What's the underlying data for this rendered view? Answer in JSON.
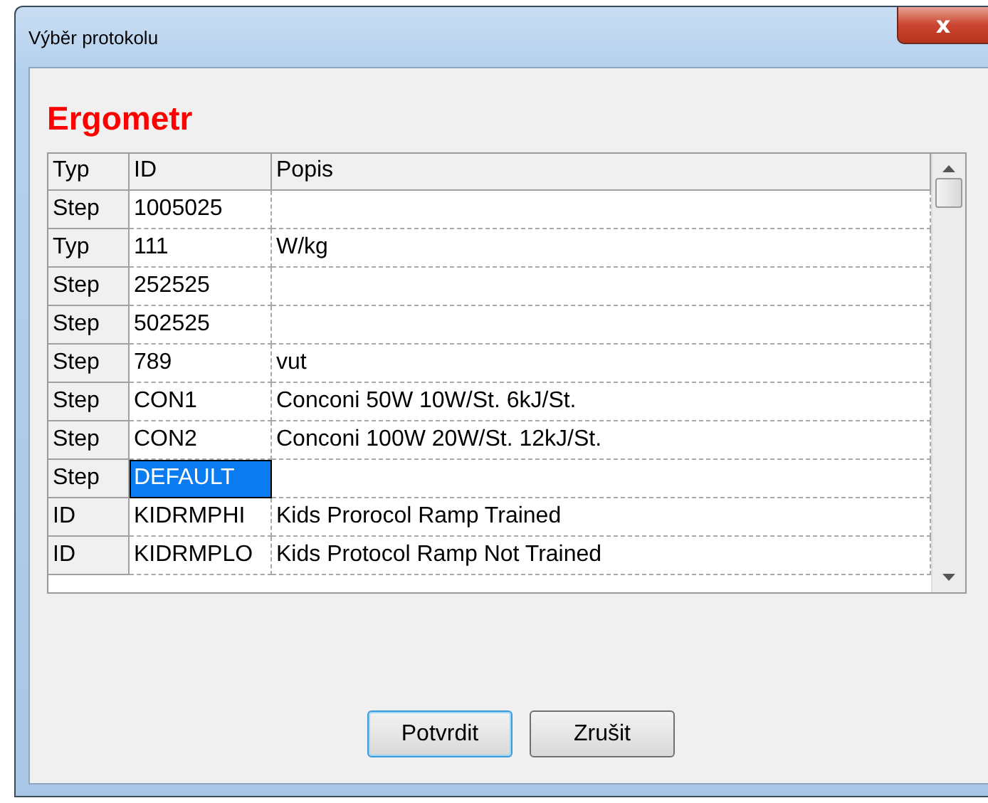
{
  "window": {
    "title": "Výběr protokolu",
    "close": "x"
  },
  "heading": "Ergometr",
  "table": {
    "columns": [
      "Typ",
      "ID",
      "Popis"
    ],
    "rows": [
      {
        "type": "Step",
        "id": "1005025",
        "description": "",
        "selected": false
      },
      {
        "type": "Typ",
        "id": "111",
        "description": "W/kg",
        "selected": false
      },
      {
        "type": "Step",
        "id": "252525",
        "description": "",
        "selected": false
      },
      {
        "type": "Step",
        "id": "502525",
        "description": "",
        "selected": false
      },
      {
        "type": "Step",
        "id": "789",
        "description": "vut",
        "selected": false
      },
      {
        "type": "Step",
        "id": "CON1",
        "description": "Conconi 50W 10W/St. 6kJ/St.",
        "selected": false
      },
      {
        "type": "Step",
        "id": "CON2",
        "description": "Conconi 100W 20W/St. 12kJ/St.",
        "selected": false
      },
      {
        "type": "Step",
        "id": "DEFAULT",
        "description": "",
        "selected": true
      },
      {
        "type": "ID",
        "id": "KIDRMPHI",
        "description": "Kids Prorocol Ramp Trained",
        "selected": false
      },
      {
        "type": "ID",
        "id": "KIDRMPLO",
        "description": "Kids Protocol Ramp Not Trained",
        "selected": false
      }
    ]
  },
  "buttons": [
    {
      "label": "Potvrdit",
      "default": true
    },
    {
      "label": "Zrušit",
      "default": false
    }
  ]
}
